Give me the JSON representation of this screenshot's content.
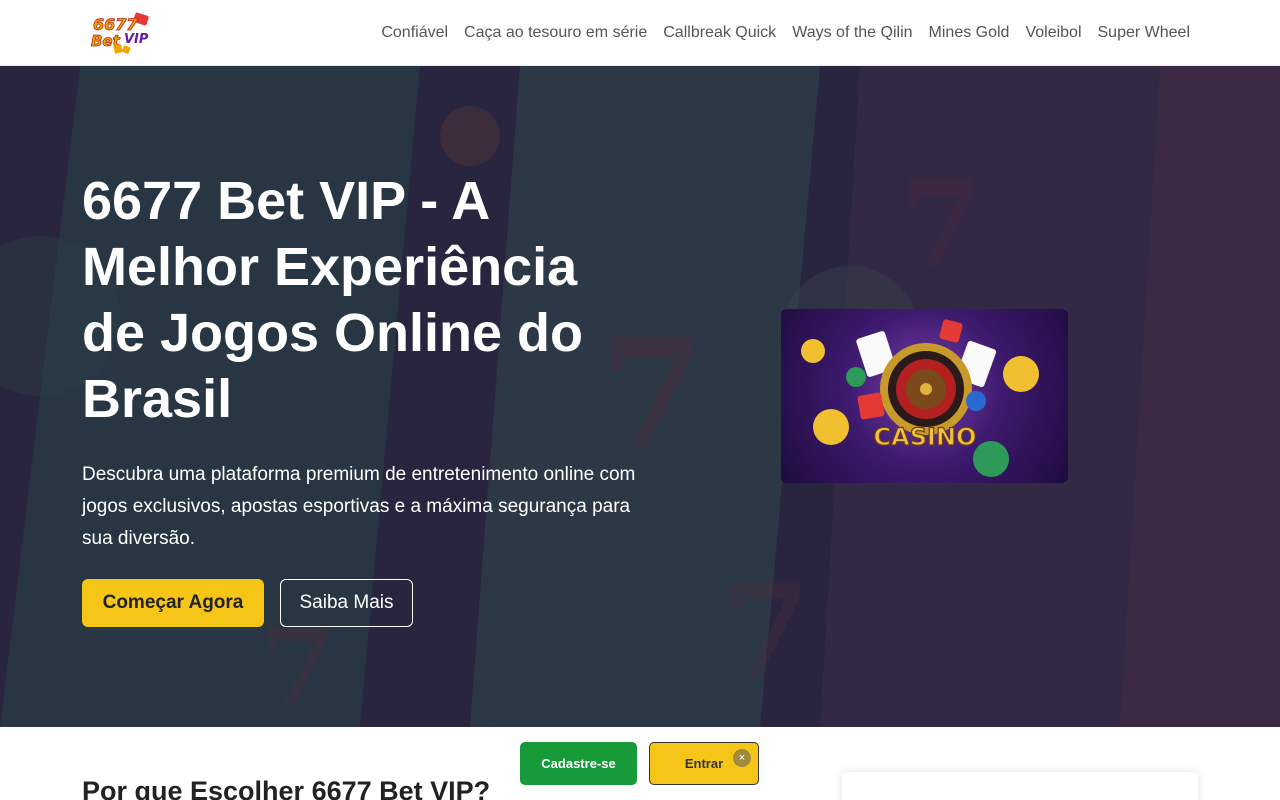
{
  "header": {
    "logo_text": "6677 Bet VIP",
    "nav": [
      {
        "label": "Confiável"
      },
      {
        "label": "Caça ao tesouro em série"
      },
      {
        "label": "Callbreak Quick"
      },
      {
        "label": "Ways of the Qilin"
      },
      {
        "label": "Mines Gold"
      },
      {
        "label": "Voleibol"
      },
      {
        "label": "Super Wheel"
      }
    ]
  },
  "hero": {
    "title": "6677 Bet VIP - A Melhor Experiência de Jogos Online do Brasil",
    "description": "Descubra uma plataforma premium de entretenimento online com jogos exclusivos, apostas esportivas e a máxima segurança para sua diversão.",
    "primary_button": "Começar Agora",
    "secondary_button": "Saiba Mais",
    "image_text": "CASINO"
  },
  "features": {
    "title": "Por que Escolher 6677 Bet VIP?"
  },
  "floating_bar": {
    "register_label": "Cadastre-se",
    "login_label": "Entrar",
    "close_glyph": "×"
  },
  "colors": {
    "accent_yellow": "#f5c518",
    "register_green": "#179b3a"
  }
}
